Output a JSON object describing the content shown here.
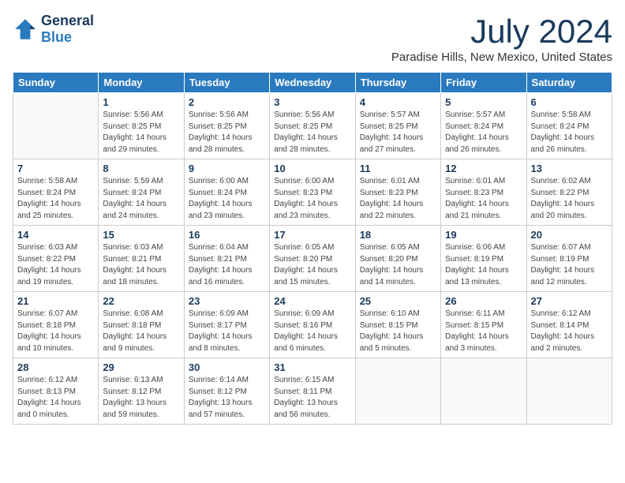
{
  "logo": {
    "general": "General",
    "blue": "Blue"
  },
  "title": "July 2024",
  "location": "Paradise Hills, New Mexico, United States",
  "weekdays": [
    "Sunday",
    "Monday",
    "Tuesday",
    "Wednesday",
    "Thursday",
    "Friday",
    "Saturday"
  ],
  "weeks": [
    [
      {
        "day": "",
        "info": ""
      },
      {
        "day": "1",
        "info": "Sunrise: 5:56 AM\nSunset: 8:25 PM\nDaylight: 14 hours\nand 29 minutes."
      },
      {
        "day": "2",
        "info": "Sunrise: 5:56 AM\nSunset: 8:25 PM\nDaylight: 14 hours\nand 28 minutes."
      },
      {
        "day": "3",
        "info": "Sunrise: 5:56 AM\nSunset: 8:25 PM\nDaylight: 14 hours\nand 28 minutes."
      },
      {
        "day": "4",
        "info": "Sunrise: 5:57 AM\nSunset: 8:25 PM\nDaylight: 14 hours\nand 27 minutes."
      },
      {
        "day": "5",
        "info": "Sunrise: 5:57 AM\nSunset: 8:24 PM\nDaylight: 14 hours\nand 26 minutes."
      },
      {
        "day": "6",
        "info": "Sunrise: 5:58 AM\nSunset: 8:24 PM\nDaylight: 14 hours\nand 26 minutes."
      }
    ],
    [
      {
        "day": "7",
        "info": "Sunrise: 5:58 AM\nSunset: 8:24 PM\nDaylight: 14 hours\nand 25 minutes."
      },
      {
        "day": "8",
        "info": "Sunrise: 5:59 AM\nSunset: 8:24 PM\nDaylight: 14 hours\nand 24 minutes."
      },
      {
        "day": "9",
        "info": "Sunrise: 6:00 AM\nSunset: 8:24 PM\nDaylight: 14 hours\nand 23 minutes."
      },
      {
        "day": "10",
        "info": "Sunrise: 6:00 AM\nSunset: 8:23 PM\nDaylight: 14 hours\nand 23 minutes."
      },
      {
        "day": "11",
        "info": "Sunrise: 6:01 AM\nSunset: 8:23 PM\nDaylight: 14 hours\nand 22 minutes."
      },
      {
        "day": "12",
        "info": "Sunrise: 6:01 AM\nSunset: 8:23 PM\nDaylight: 14 hours\nand 21 minutes."
      },
      {
        "day": "13",
        "info": "Sunrise: 6:02 AM\nSunset: 8:22 PM\nDaylight: 14 hours\nand 20 minutes."
      }
    ],
    [
      {
        "day": "14",
        "info": "Sunrise: 6:03 AM\nSunset: 8:22 PM\nDaylight: 14 hours\nand 19 minutes."
      },
      {
        "day": "15",
        "info": "Sunrise: 6:03 AM\nSunset: 8:21 PM\nDaylight: 14 hours\nand 18 minutes."
      },
      {
        "day": "16",
        "info": "Sunrise: 6:04 AM\nSunset: 8:21 PM\nDaylight: 14 hours\nand 16 minutes."
      },
      {
        "day": "17",
        "info": "Sunrise: 6:05 AM\nSunset: 8:20 PM\nDaylight: 14 hours\nand 15 minutes."
      },
      {
        "day": "18",
        "info": "Sunrise: 6:05 AM\nSunset: 8:20 PM\nDaylight: 14 hours\nand 14 minutes."
      },
      {
        "day": "19",
        "info": "Sunrise: 6:06 AM\nSunset: 8:19 PM\nDaylight: 14 hours\nand 13 minutes."
      },
      {
        "day": "20",
        "info": "Sunrise: 6:07 AM\nSunset: 8:19 PM\nDaylight: 14 hours\nand 12 minutes."
      }
    ],
    [
      {
        "day": "21",
        "info": "Sunrise: 6:07 AM\nSunset: 8:18 PM\nDaylight: 14 hours\nand 10 minutes."
      },
      {
        "day": "22",
        "info": "Sunrise: 6:08 AM\nSunset: 8:18 PM\nDaylight: 14 hours\nand 9 minutes."
      },
      {
        "day": "23",
        "info": "Sunrise: 6:09 AM\nSunset: 8:17 PM\nDaylight: 14 hours\nand 8 minutes."
      },
      {
        "day": "24",
        "info": "Sunrise: 6:09 AM\nSunset: 8:16 PM\nDaylight: 14 hours\nand 6 minutes."
      },
      {
        "day": "25",
        "info": "Sunrise: 6:10 AM\nSunset: 8:15 PM\nDaylight: 14 hours\nand 5 minutes."
      },
      {
        "day": "26",
        "info": "Sunrise: 6:11 AM\nSunset: 8:15 PM\nDaylight: 14 hours\nand 3 minutes."
      },
      {
        "day": "27",
        "info": "Sunrise: 6:12 AM\nSunset: 8:14 PM\nDaylight: 14 hours\nand 2 minutes."
      }
    ],
    [
      {
        "day": "28",
        "info": "Sunrise: 6:12 AM\nSunset: 8:13 PM\nDaylight: 14 hours\nand 0 minutes."
      },
      {
        "day": "29",
        "info": "Sunrise: 6:13 AM\nSunset: 8:12 PM\nDaylight: 13 hours\nand 59 minutes."
      },
      {
        "day": "30",
        "info": "Sunrise: 6:14 AM\nSunset: 8:12 PM\nDaylight: 13 hours\nand 57 minutes."
      },
      {
        "day": "31",
        "info": "Sunrise: 6:15 AM\nSunset: 8:11 PM\nDaylight: 13 hours\nand 56 minutes."
      },
      {
        "day": "",
        "info": ""
      },
      {
        "day": "",
        "info": ""
      },
      {
        "day": "",
        "info": ""
      }
    ]
  ]
}
